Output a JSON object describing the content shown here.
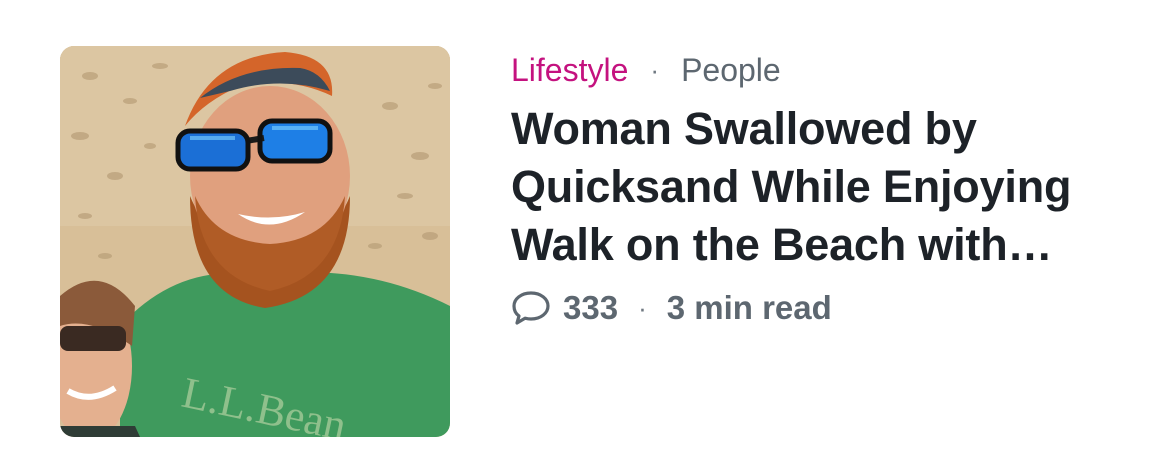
{
  "article": {
    "category": "Lifestyle",
    "separator": "·",
    "subcategory": "People",
    "headline": "Woman Swallowed by Quicksand While Enjoying Walk on the Beach with…",
    "comment_count": "333",
    "read_time": "3 min read",
    "thumbnail_shirt_text": "L.L.Bean"
  },
  "colors": {
    "category": "#c4127f",
    "headline": "#1d2228",
    "meta": "#5d6770"
  }
}
